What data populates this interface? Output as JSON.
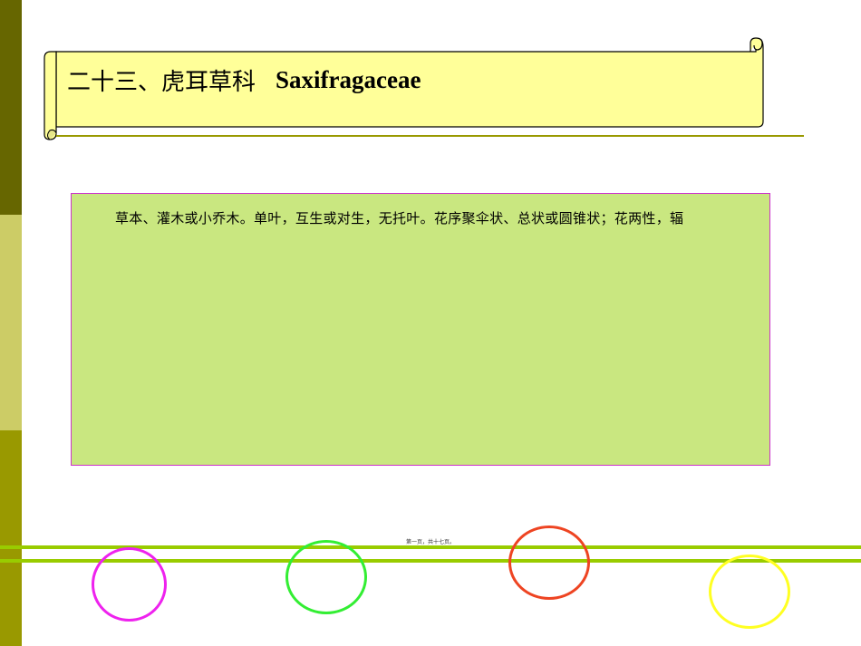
{
  "slide": {
    "title_cn": "二十三、虎耳草科",
    "title_en": "Saxifragaceae",
    "body_text": "草本、灌木或小乔木。单叶，互生或对生，无托叶。花序聚伞状、总状或圆锥状；花两性，辐",
    "page_label": "第一页，共十七页。"
  },
  "colors": {
    "scroll_fill": "#ffff99",
    "left_bar": [
      "#666600",
      "#cccc66",
      "#999900"
    ],
    "content_bg": "#c9e780",
    "content_border": "#cc33cc",
    "footer_lines": "#99cc00",
    "rings": [
      "#ee22ee",
      "#33ee33",
      "#ee4422",
      "#ffff22"
    ]
  }
}
